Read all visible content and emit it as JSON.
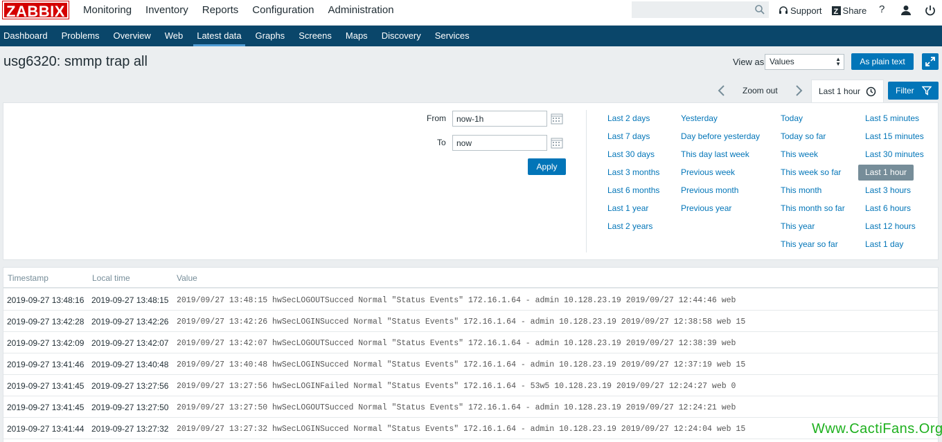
{
  "brand": "ZABBIX",
  "main_nav": [
    "Monitoring",
    "Inventory",
    "Reports",
    "Configuration",
    "Administration"
  ],
  "top_links": {
    "support": "Support",
    "share": "Share",
    "help": "?"
  },
  "search": {
    "value": ""
  },
  "sub_nav": [
    "Dashboard",
    "Problems",
    "Overview",
    "Web",
    "Latest data",
    "Graphs",
    "Screens",
    "Maps",
    "Discovery",
    "Services"
  ],
  "page": {
    "title": "usg6320: smmp trap all",
    "view_as_label": "View as",
    "view_as_value": "Values",
    "plain_text_button": "As plain text"
  },
  "time_nav": {
    "zoom_out": "Zoom out",
    "active_tab": "Last 1 hour",
    "filter": "Filter"
  },
  "filter": {
    "from_label": "From",
    "from_value": "now-1h",
    "to_label": "To",
    "to_value": "now",
    "apply": "Apply",
    "quick_ranges": [
      [
        "Last 2 days",
        "Last 7 days",
        "Last 30 days",
        "Last 3 months",
        "Last 6 months",
        "Last 1 year",
        "Last 2 years"
      ],
      [
        "Yesterday",
        "Day before yesterday",
        "This day last week",
        "Previous week",
        "Previous month",
        "Previous year"
      ],
      [
        "Today",
        "Today so far",
        "This week",
        "This week so far",
        "This month",
        "This month so far",
        "This year",
        "This year so far"
      ],
      [
        "Last 5 minutes",
        "Last 15 minutes",
        "Last 30 minutes",
        "Last 1 hour",
        "Last 3 hours",
        "Last 6 hours",
        "Last 12 hours",
        "Last 1 day"
      ]
    ],
    "selected_range": "Last 1 hour"
  },
  "table": {
    "headers": [
      "Timestamp",
      "Local time",
      "Value"
    ],
    "rows": [
      [
        "2019-09-27 13:48:16",
        "2019-09-27 13:48:15",
        "2019/09/27 13:48:15 hwSecLOGOUTSucced Normal \"Status Events\" 172.16.1.64 - admin 10.128.23.19 2019/09/27 12:44:46 web"
      ],
      [
        "2019-09-27 13:42:28",
        "2019-09-27 13:42:26",
        "2019/09/27 13:42:26 hwSecLOGINSucced Normal \"Status Events\" 172.16.1.64 - admin 10.128.23.19 2019/09/27 12:38:58 web 15"
      ],
      [
        "2019-09-27 13:42:09",
        "2019-09-27 13:42:07",
        "2019/09/27 13:42:07 hwSecLOGOUTSucced Normal \"Status Events\" 172.16.1.64 - admin 10.128.23.19 2019/09/27 12:38:39 web"
      ],
      [
        "2019-09-27 13:41:46",
        "2019-09-27 13:40:48",
        "2019/09/27 13:40:48 hwSecLOGINSucced Normal \"Status Events\" 172.16.1.64 - admin 10.128.23.19 2019/09/27 12:37:19 web 15"
      ],
      [
        "2019-09-27 13:41:45",
        "2019-09-27 13:27:56",
        "2019/09/27 13:27:56 hwSecLOGINFailed Normal \"Status Events\" 172.16.1.64 - 53w5 10.128.23.19 2019/09/27 12:24:27 web 0"
      ],
      [
        "2019-09-27 13:41:45",
        "2019-09-27 13:27:50",
        "2019/09/27 13:27:50 hwSecLOGOUTSucced Normal \"Status Events\" 172.16.1.64 - admin 10.128.23.19 2019/09/27 12:24:21 web"
      ],
      [
        "2019-09-27 13:41:44",
        "2019-09-27 13:27:32",
        "2019/09/27 13:27:32 hwSecLOGINSucced Normal \"Status Events\" 172.16.1.64 - admin 10.128.23.19 2019/09/27 12:24:04 web 15"
      ]
    ]
  },
  "watermark": "Www.CactiFans.Org",
  "icons": {
    "search": "search-icon",
    "support": "headset-icon",
    "share": "share-icon",
    "user": "user-icon",
    "power": "power-icon",
    "fullscreen": "fullscreen-icon",
    "clock": "clock-icon",
    "filter": "funnel-icon",
    "calendar": "calendar-icon"
  },
  "colors": {
    "brand_red": "#d40000",
    "subnav_bg": "#0a466a",
    "primary_button": "#0275b8",
    "link": "#0275b8",
    "selected_range_bg": "#768d99",
    "watermark": "#1db01d"
  }
}
